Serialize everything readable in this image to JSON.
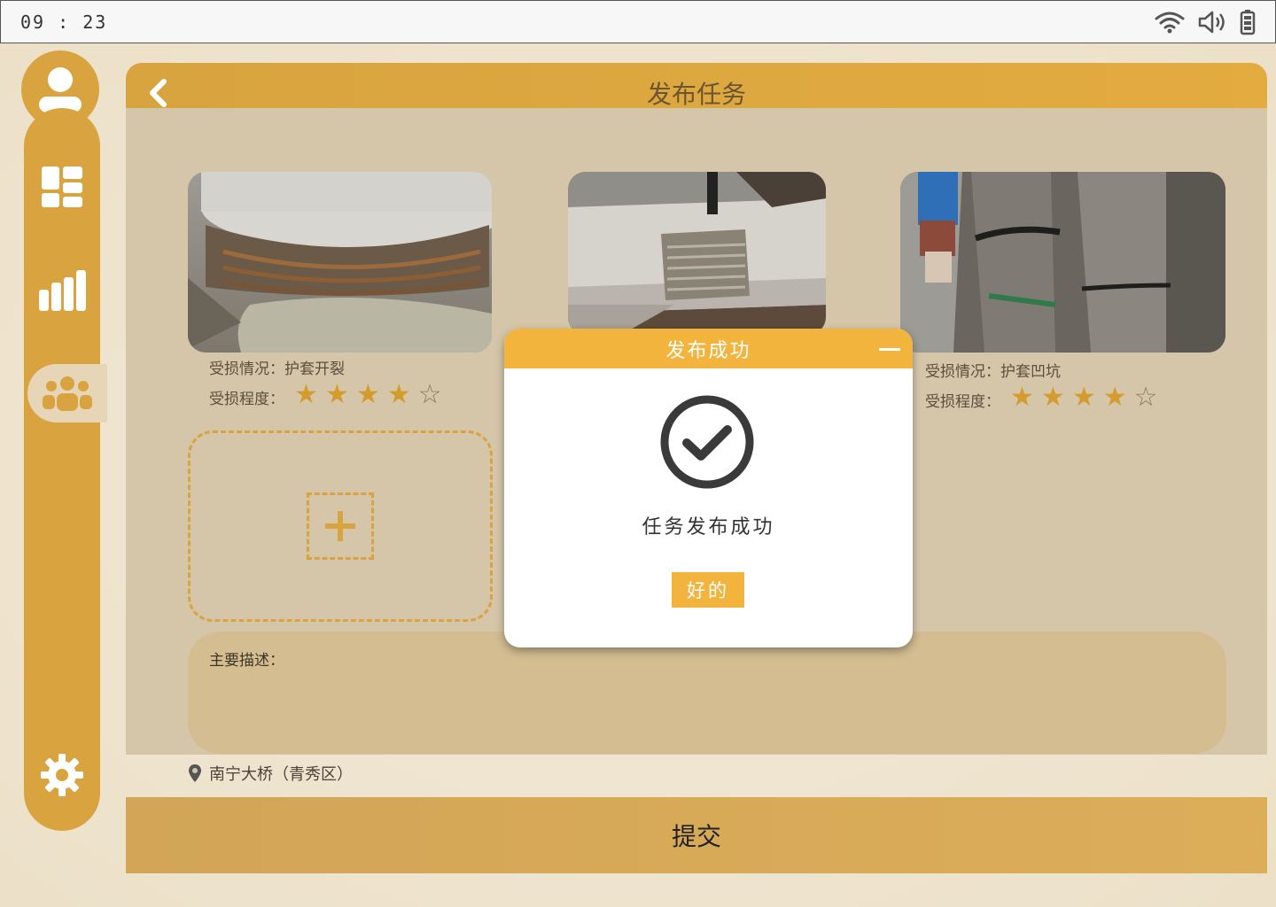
{
  "status_bar": {
    "time": "09 : 23",
    "icons": [
      "wifi-icon",
      "volume-icon",
      "battery-icon"
    ]
  },
  "header": {
    "title": "发布任务",
    "back_icon": "chevron-left-icon"
  },
  "sidebar": {
    "avatar_icon": "user-icon",
    "items": [
      {
        "icon": "dashboard-icon",
        "active": false
      },
      {
        "icon": "bar-chart-icon",
        "active": false
      },
      {
        "icon": "users-icon",
        "active": true
      }
    ],
    "settings_icon": "gear-icon"
  },
  "photos": [
    {
      "damage_label": "受损情况：",
      "damage_value": "护套开裂",
      "severity_label": "受损程度：",
      "rating": 4,
      "max": 5
    },
    {
      "damage_label": "",
      "damage_value": "",
      "severity_label": "",
      "rating": null,
      "max": 5
    },
    {
      "damage_label": "受损情况：",
      "damage_value": "护套凹坑",
      "severity_label": "受损程度：",
      "rating": 4,
      "max": 5
    }
  ],
  "upload": {
    "icon": "plus-icon"
  },
  "description": {
    "label": "主要描述："
  },
  "location": {
    "icon": "map-pin-icon",
    "text": "南宁大桥（青秀区）"
  },
  "submit": {
    "label": "提交"
  },
  "modal": {
    "title": "发布成功",
    "message": "任务发布成功",
    "ok_label": "好的",
    "icon": "check-circle-icon"
  },
  "colors": {
    "accent": "#d9a33f",
    "modal_header": "#f2b43d",
    "content_bg": "#d5c6a9"
  }
}
